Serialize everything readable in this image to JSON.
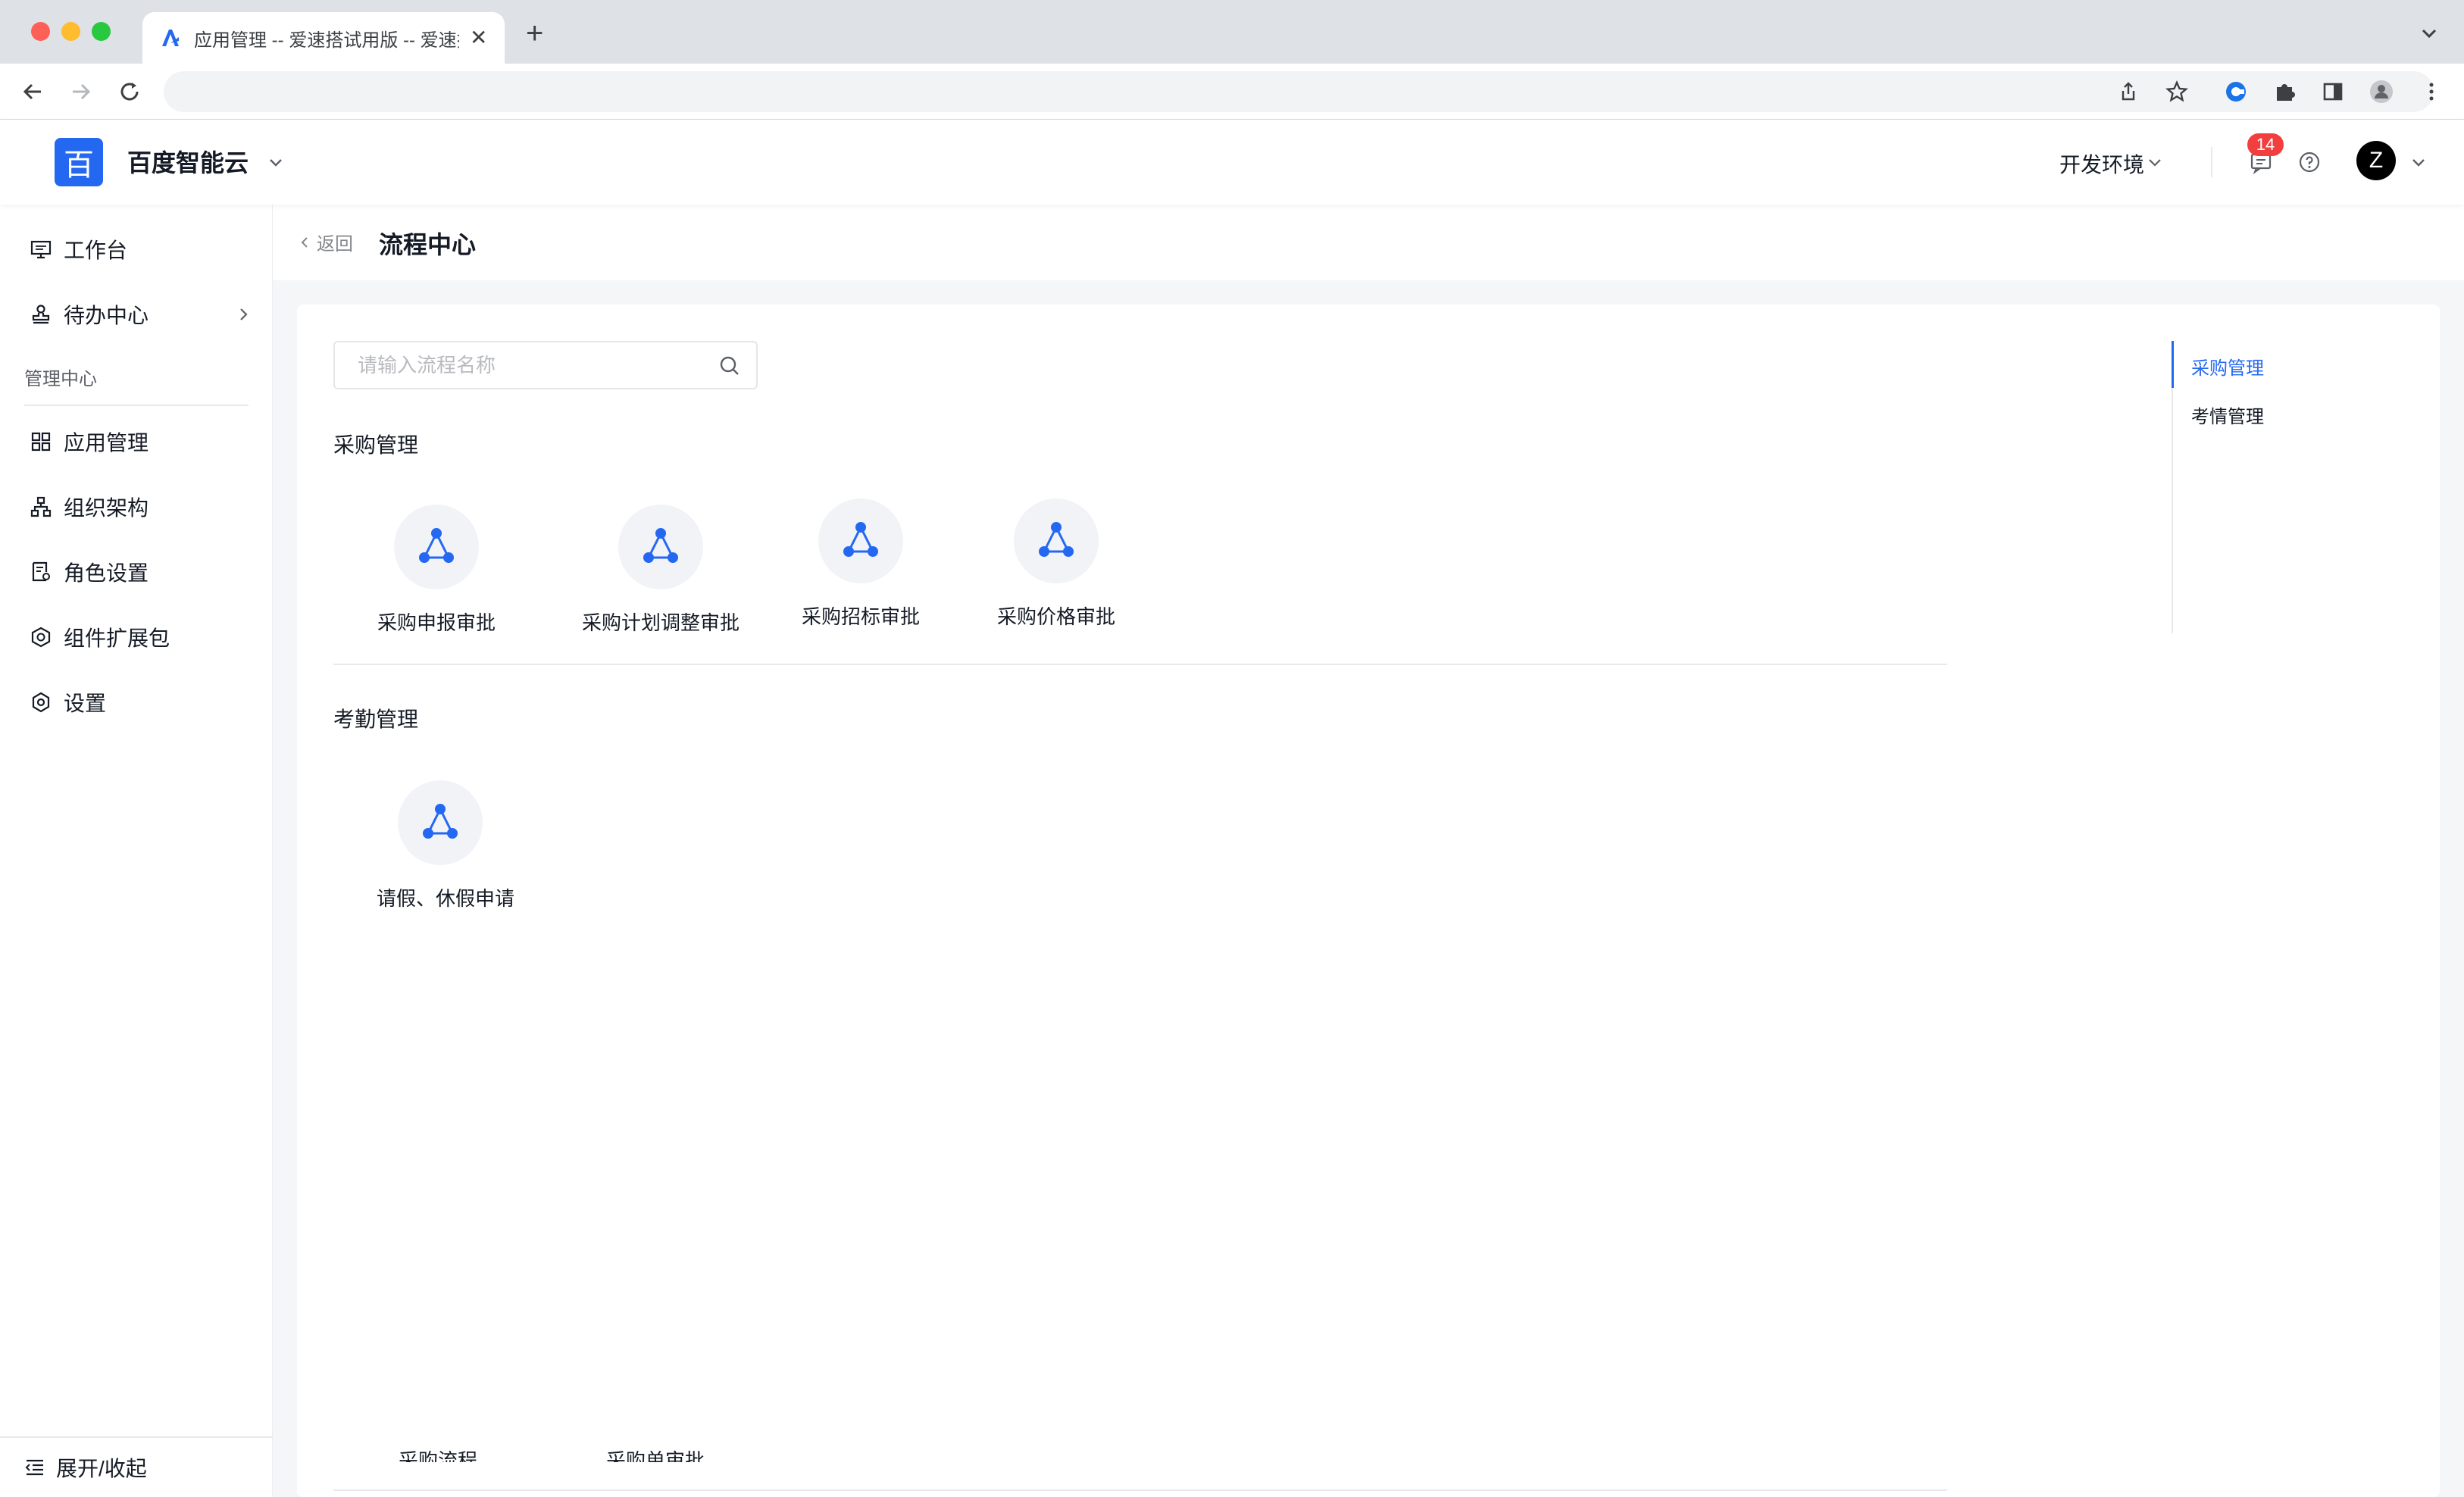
{
  "browser": {
    "tab_title": "应用管理 -- 爱速搭试用版 -- 爱速搭",
    "close_glyph": "✕",
    "new_tab_glyph": "+"
  },
  "header": {
    "logo_char": "百",
    "brand": "百度智能云",
    "env": "开发环境",
    "notifications": "14",
    "avatar_letter": "Z"
  },
  "sidebar": {
    "items": [
      {
        "label": "工作台",
        "icon": "monitor-icon"
      },
      {
        "label": "待办中心",
        "icon": "stamp-icon"
      }
    ],
    "section": "管理中心",
    "manage_items": [
      {
        "label": "应用管理",
        "icon": "grid-icon"
      },
      {
        "label": "组织架构",
        "icon": "org-icon"
      },
      {
        "label": "角色设置",
        "icon": "role-icon"
      },
      {
        "label": "组件扩展包",
        "icon": "package-icon"
      },
      {
        "label": "设置",
        "icon": "gear-icon"
      }
    ],
    "footer": "展开/收起"
  },
  "page": {
    "back": "返回",
    "title": "流程中心",
    "search_placeholder": "请输入流程名称"
  },
  "groups": [
    {
      "title": "采购管理",
      "flows": [
        "采购申报审批",
        "采购计划调整审批",
        "采购招标审批",
        "采购价格审批"
      ]
    },
    {
      "title": "考勤管理",
      "flows": [
        "请假、休假申请"
      ]
    }
  ],
  "ghost_flows": [
    "采购流程",
    "采购单审批"
  ],
  "anchors": [
    "采购管理",
    "考情管理"
  ],
  "colors": {
    "primary": "#2468f2",
    "badge": "#f33e3e"
  }
}
